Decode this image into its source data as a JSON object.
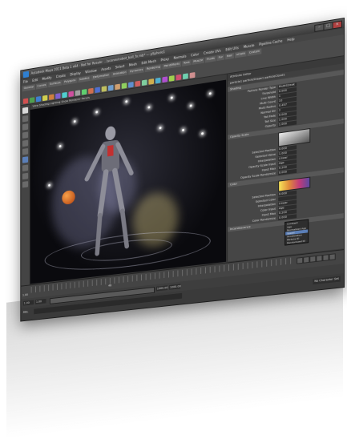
{
  "window": {
    "title": "Autodesk Maya 2011 Beta 1 x64 - Not for Resale: ...\\scenes\\robot_ball_fx.mb* --- pSphere1"
  },
  "menubar": [
    "File",
    "Edit",
    "Modify",
    "Create",
    "Display",
    "Window",
    "Assets",
    "Select",
    "Mesh",
    "Edit Mesh",
    "Proxy",
    "Normals",
    "Color",
    "Create UVs",
    "Edit UVs",
    "Muscle",
    "Pipeline Cache",
    "Help"
  ],
  "shelf": {
    "tabs": [
      "General",
      "Curves",
      "Surfaces",
      "Polygons",
      "Subdivs",
      "Deformation",
      "Animation",
      "Dynamics",
      "Rendering",
      "PaintEffects",
      "Toon",
      "Muscle",
      "Fluids",
      "Fur",
      "Hair",
      "nCloth",
      "Custom"
    ],
    "icon_colors": [
      "#d05050",
      "#4f9f4f",
      "#3f7fcf",
      "#cfcf4f",
      "#cf7f3f",
      "#7f5fcf",
      "#4fcfcf",
      "#cf4f9f",
      "#9f9f9f",
      "#5fcf6f",
      "#cf6f4f",
      "#4f6fcf",
      "#bfbf5f",
      "#6f9fcf",
      "#cf9f6f",
      "#8fcf5f",
      "#5f8fcf",
      "#cf5f5f",
      "#7fcf9f",
      "#cfaf4f",
      "#4fafcf",
      "#af4fcf",
      "#9fcf4f",
      "#cf4f6f",
      "#6fcfaf",
      "#cf8f8f"
    ]
  },
  "viewport": {
    "menu": "View  Shading  Lighting  Show  Renderer  Panels"
  },
  "attribute_editor": {
    "header": "Attribute Editor",
    "tabs": "particle1   particleShape1   particleCloud1",
    "sections": {
      "shading": "Shading",
      "opacity": "Opacity Scale",
      "color": "Color",
      "incandescence": "Incandescence"
    },
    "rows": [
      {
        "label": "Particle Render Type",
        "value": "MultiStreak"
      },
      {
        "label": "Threshold",
        "value": "0.000"
      },
      {
        "label": "Line Width",
        "value": "1"
      },
      {
        "label": "Multi Count",
        "value": "10"
      },
      {
        "label": "Multi Radius",
        "value": "0.457"
      },
      {
        "label": "Normal Dir",
        "value": "2"
      },
      {
        "label": "Tail Fade",
        "value": "0.000"
      },
      {
        "label": "Tail Size",
        "value": "1.000"
      },
      {
        "label": "Opacity",
        "value": "1.000"
      }
    ],
    "opacity_rows": [
      {
        "label": "Selected Position",
        "value": "0.000"
      },
      {
        "label": "Selected Value",
        "value": "1.000"
      },
      {
        "label": "Interpolation",
        "value": "Linear"
      },
      {
        "label": "Opacity Scale Input",
        "value": "Age"
      },
      {
        "label": "Input Max",
        "value": "0.200"
      },
      {
        "label": "Opacity Scale Randomize",
        "value": "0.000"
      }
    ],
    "color_rows": [
      {
        "label": "Selected Position",
        "value": "0.000"
      },
      {
        "label": "Selected Color",
        "value": ""
      },
      {
        "label": "Interpolation",
        "value": "Linear"
      },
      {
        "label": "Color Input",
        "value": "Age"
      },
      {
        "label": "Input Max",
        "value": "0.200"
      },
      {
        "label": "Color Randomize",
        "value": "0.000"
      }
    ],
    "dropdown_options": [
      "Constant",
      "Age",
      "Normalized Age",
      "Speed",
      "Acceleration",
      "Particle ID",
      "Randomized ID"
    ],
    "dropdown_selected": "Speed"
  },
  "timeline": {
    "start": "1.00",
    "end": "250.00",
    "current": "48"
  },
  "range": {
    "start": "1.00",
    "end": "1000.00",
    "anim_start": "1.00",
    "anim_end": "1000.00"
  },
  "command": {
    "label": "MEL",
    "character_set": "No Character Set"
  }
}
